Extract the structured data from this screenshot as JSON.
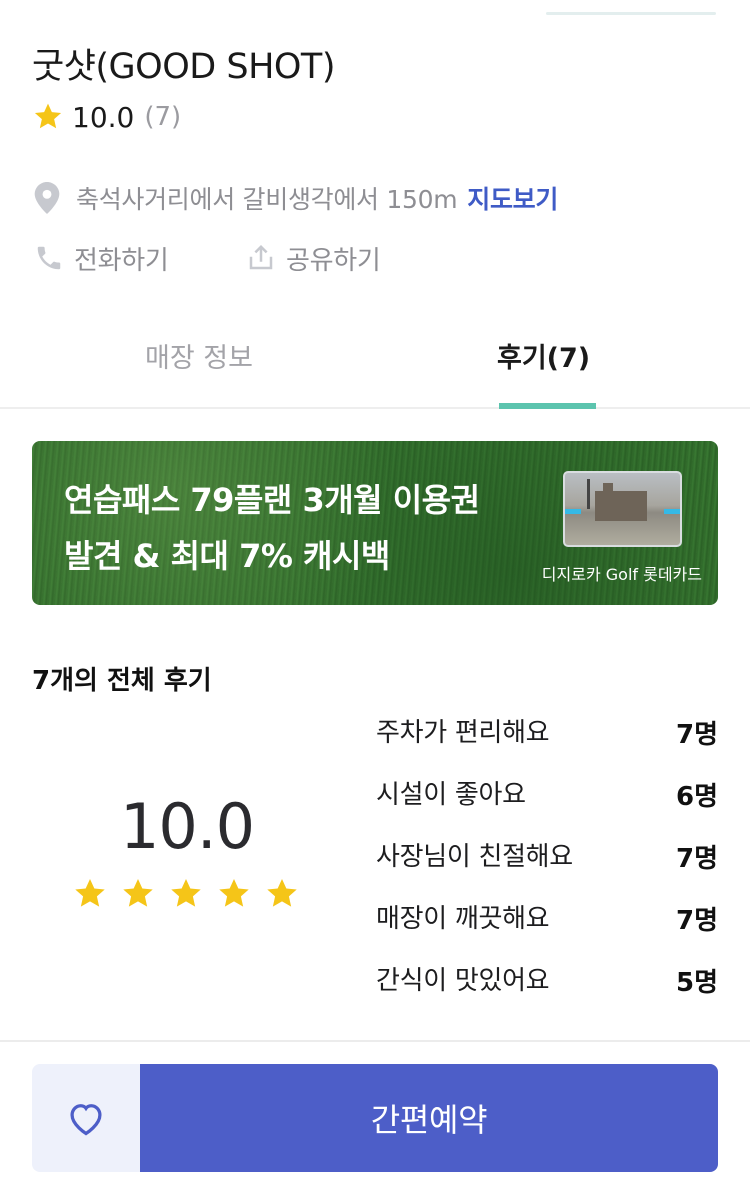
{
  "store": {
    "title": "굿샷(GOOD SHOT)",
    "rating": "10.0",
    "rating_count": "(7)"
  },
  "location": {
    "address": "축석사거리에서 갈비생각에서 150m",
    "map_link": "지도보기"
  },
  "actions": {
    "call": "전화하기",
    "share": "공유하기"
  },
  "tabs": [
    {
      "label": "매장 정보",
      "active": false
    },
    {
      "label": "후기(7)",
      "active": true
    }
  ],
  "banner": {
    "line1": "연습패스 79플랜 3개월 이용권",
    "line2": "발견 & 최대 7% 캐시백",
    "footer": "디지로카 Golf  롯데카드"
  },
  "reviews": {
    "heading": "7개의 전체 후기",
    "score": "10.0",
    "stars": 5,
    "keywords": [
      {
        "label": "주차가 편리해요",
        "count": "7명"
      },
      {
        "label": "시설이 좋아요",
        "count": "6명"
      },
      {
        "label": "사장님이 친절해요",
        "count": "7명"
      },
      {
        "label": "매장이 깨끗해요",
        "count": "7명"
      },
      {
        "label": "간식이 맛있어요",
        "count": "5명"
      }
    ]
  },
  "bottom_bar": {
    "reserve_label": "간편예약"
  },
  "colors": {
    "accent": "#4d5ec8",
    "tab_underline": "#5cc4ae",
    "star": "#f5c518",
    "link": "#3f5bc6"
  },
  "icons": [
    "star-icon",
    "map-pin-icon",
    "phone-icon",
    "share-icon",
    "heart-icon"
  ]
}
